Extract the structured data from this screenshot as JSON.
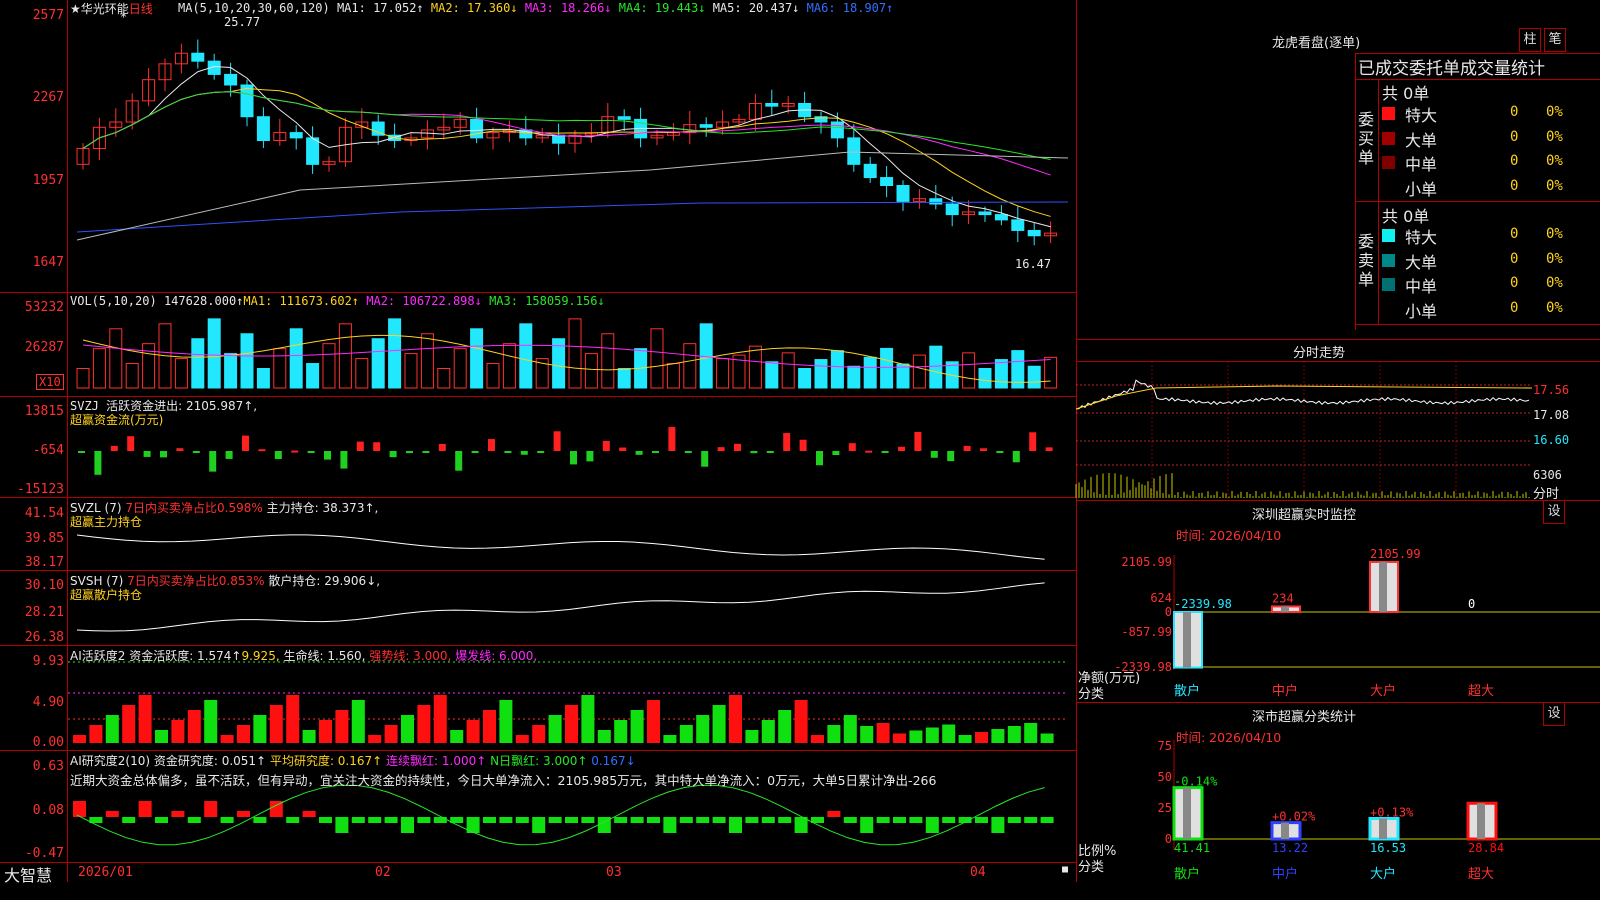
{
  "header": {
    "star": "★",
    "stock_name": "华光环能",
    "period": "日线",
    "ma_label": "MA(5,10,20,30,60,120)",
    "ma1": "MA1: 17.052↑",
    "ma2": "MA2: 17.360↓",
    "ma3": "MA3: 18.266↓",
    "ma4": "MA4: 19.443↓",
    "ma5": "MA5: 20.437↓",
    "ma6": "MA6: 18.907↑",
    "high_note": "25.77",
    "low_note": "16.47",
    "marker": "*"
  },
  "price_axis": [
    "2577",
    "2267",
    "1957",
    "1647"
  ],
  "vol": {
    "label": "VOL(5,10,20)",
    "value": "147628.000↑",
    "ma1": "MA1: 111673.602↑",
    "ma2": "MA2: 106722.898↓",
    "ma3": "MA3: 158059.156↓",
    "axis": [
      "53232",
      "26287"
    ],
    "unit": "X10"
  },
  "svzj": {
    "label": "SVZJ",
    "title": "活跃资金进出: 2105.987↑,",
    "sub": "超赢资金流(万元)",
    "axis": [
      "13815",
      "-654",
      "-15123"
    ]
  },
  "svzl": {
    "label": "SVZL (7)",
    "t1": "7日内买卖净占比0.598%",
    "t2": "主力持仓: 38.373↑,",
    "sub": "超赢主力持仓",
    "axis": [
      "41.54",
      "39.85",
      "38.17"
    ]
  },
  "svsh": {
    "label": "SVSH (7)",
    "t1": "7日内买卖净占比0.853%",
    "t2": "散户持仓: 29.906↓,",
    "sub": "超赢散户持仓",
    "axis": [
      "30.10",
      "28.21",
      "26.38"
    ]
  },
  "ai1": {
    "t1": "AI活跃度2 资金活跃度: 1.574↑",
    "t2": "9.925,",
    "t3": "生命线: 1.560,",
    "t4": "强势线: 3.000,",
    "t5": "爆发线: 6.000,",
    "axis": [
      "9.93",
      "4.90",
      "0.00"
    ]
  },
  "ai2": {
    "t1": "AI研究度2(10) 资金研究度: 0.051↑",
    "t2": "平均研究度: 0.167↑",
    "t3": "连续飘红: 1.000↑",
    "t4": "N日飘红: 3.000↑",
    "t5": "0.167↓",
    "commentary": "近期大资金总体偏多，虽不活跃，但有异动，宜关注大资金的持续性，今日大单净流入：2105.985万元，其中特大单净流入：0万元，大单5日累计净出-266",
    "axis": [
      "0.63",
      "0.08",
      "-0.47"
    ]
  },
  "dates": [
    "2026/01",
    "02",
    "03",
    "04"
  ],
  "brand": "大智慧",
  "right": {
    "dragon_title": "龙虎看盘(逐单)",
    "btn1": "柱",
    "btn2": "笔",
    "stats_title": "已成交委托单成交量统计",
    "buy": {
      "side": "委买单",
      "total": "共 0单",
      "rows": [
        {
          "name": "特大",
          "v": "0",
          "p": "0%",
          "c": "#ff1010"
        },
        {
          "name": "大单",
          "v": "0",
          "p": "0%",
          "c": "#a00000"
        },
        {
          "name": "中单",
          "v": "0",
          "p": "0%",
          "c": "#800000"
        },
        {
          "name": "小单",
          "v": "0",
          "p": "0%",
          "c": ""
        }
      ]
    },
    "sell": {
      "side": "委卖单",
      "total": "共 0单",
      "rows": [
        {
          "name": "特大",
          "v": "0",
          "p": "0%",
          "c": "#10f0f0"
        },
        {
          "name": "大单",
          "v": "0",
          "p": "0%",
          "c": "#008888"
        },
        {
          "name": "中单",
          "v": "0",
          "p": "0%",
          "c": "#007070"
        },
        {
          "name": "小单",
          "v": "0",
          "p": "0%",
          "c": ""
        }
      ]
    },
    "intraday_title": "分时走势",
    "intraday_axis": [
      "17.56",
      "17.08",
      "16.60",
      "6306"
    ],
    "intraday_unit": "分时",
    "sz_title": "深圳超赢实时监控",
    "sz_btn": "设",
    "sz_time": "时间: 2026/04/10",
    "sz_axis": [
      "2105.99",
      "624",
      "0",
      "-857.99",
      "-2339.98"
    ],
    "sz_ylabel": "净额(万元)",
    "sz_xlabel": "分类",
    "sz_chart": {
      "categories": [
        "散户",
        "中户",
        "大户",
        "超大"
      ],
      "values": [
        -2339.98,
        234,
        2105.99,
        0
      ],
      "labels": [
        "-2339.98",
        "234",
        "2105.99",
        "0"
      ]
    },
    "ss_title": "深市超赢分类统计",
    "ss_btn": "设",
    "ss_time": "时间: 2026/04/10",
    "ss_axis": [
      "75",
      "50",
      "25",
      "0"
    ],
    "ss_ylabel": "比例%",
    "ss_xlabel": "分类",
    "ss_chart": {
      "categories": [
        "散户",
        "中户",
        "大户",
        "超大"
      ],
      "values": [
        41.41,
        13.22,
        16.53,
        28.84
      ],
      "changes": [
        "-0.14%",
        "+0.02%",
        "+0.13%",
        ""
      ],
      "labels": [
        "41.41",
        "13.22",
        "16.53",
        "28.84"
      ]
    }
  },
  "chart_data": {
    "type": "bar",
    "title": "华光环能 日线",
    "categories": [
      "2026/01",
      "02",
      "03",
      "04"
    ],
    "price_range": [
      16.47,
      25.77
    ],
    "moving_averages": {
      "MA1": 17.052,
      "MA2": 17.36,
      "MA3": 18.266,
      "MA4": 19.443,
      "MA5": 20.437,
      "MA6": 18.907
    },
    "volume": {
      "last": 147628.0,
      "MA1": 111673.602,
      "MA2": 106722.898,
      "MA3": 158059.156
    },
    "sz_net_amount": {
      "categories": [
        "散户",
        "中户",
        "大户",
        "超大"
      ],
      "values": [
        -2339.98,
        234,
        2105.99,
        0
      ]
    },
    "sz_ratio": {
      "categories": [
        "散户",
        "中户",
        "大户",
        "超大"
      ],
      "values": [
        41.41,
        13.22,
        16.53,
        28.84
      ]
    }
  }
}
